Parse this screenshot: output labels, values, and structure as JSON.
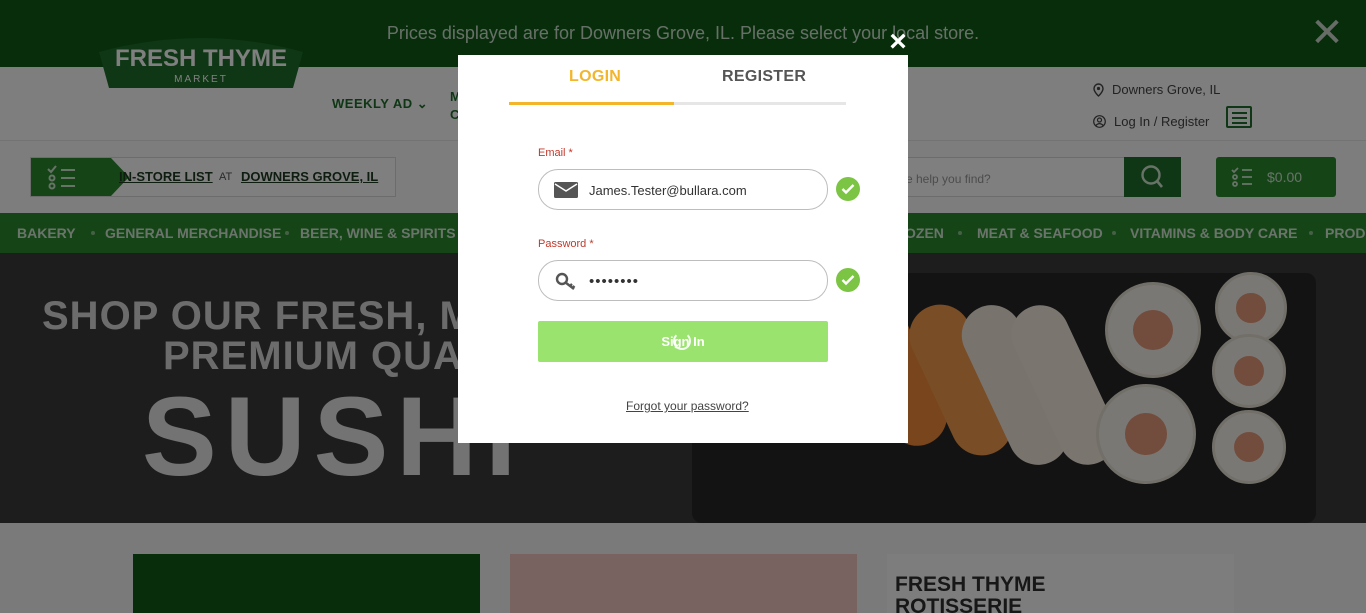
{
  "banner": {
    "message": "Prices displayed are for Downers Grove, IL. Please select your local store.",
    "close": "✕"
  },
  "header": {
    "logo_main": "FRESH THYME",
    "logo_sub": "MARKET",
    "nav_weekly": "WEEKLY AD",
    "nav_more_1": "M",
    "nav_more_2": "C",
    "location": "Downers Grove, IL",
    "account": "Log In / Register"
  },
  "store_bar": {
    "list_label": "IN-STORE LIST",
    "at": "AT",
    "store": "DOWNERS GROVE, IL"
  },
  "search": {
    "placeholder": "e help you find?"
  },
  "cart": {
    "amount": "$0.00"
  },
  "categories": [
    "BAKERY",
    "GENERAL MERCHANDISE",
    "BEER, WINE & SPIRITS",
    "OZEN",
    "MEAT & SEAFOOD",
    "VITAMINS & BODY CARE",
    "PRODU"
  ],
  "hero": {
    "line1": "SHOP OUR FRESH, MA",
    "line2": "PREMIUM QUA",
    "line3": "SUSHI"
  },
  "promo": {
    "card3_line1": "FRESH THYME",
    "card3_line2": "ROTISSERIE"
  },
  "modal": {
    "close": "×",
    "tabs": {
      "login": "LOGIN",
      "register": "REGISTER"
    },
    "email": {
      "label": "Email *",
      "value": "James.Tester@bullara.com"
    },
    "password": {
      "label": "Password *",
      "value": "••••••••"
    },
    "signin_label": "Sign In",
    "forgot_label": "Forgot your password?"
  },
  "colors": {
    "brand_green": "#2a8a2e",
    "tab_active": "#f3b52b",
    "signin_button": "#9be36f",
    "valid_check": "#7cc443",
    "required_label": "#c0392b"
  }
}
